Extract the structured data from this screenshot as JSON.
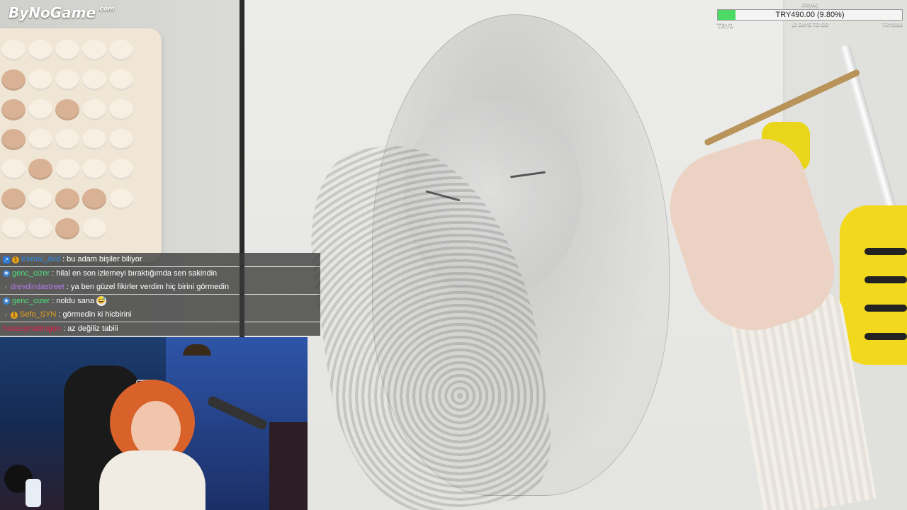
{
  "logo": {
    "text": "ByNoGame",
    "suffix": ".com"
  },
  "goal": {
    "title": "ihtiyaç",
    "amount": "TRY490.00 (9.80%)",
    "progress_percent": 9.8,
    "start_label": "TRY0",
    "days_left": "12 DAYS TO GO",
    "end_label": "TRY5000",
    "fill_color": "#4cd964"
  },
  "chat": {
    "messages": [
      {
        "badges": [
          "square",
          "coin"
        ],
        "user": "Kemal_dvd",
        "user_color": "#2b86e0",
        "text": ": bu adam bişiler biliyor"
      },
      {
        "badges": [
          "star"
        ],
        "user": "genc_cizer",
        "user_color": "#4de07a",
        "text": ": hilal en son izlemeyi bıraktığımda sen sakindin"
      },
      {
        "badges": [
          "arrow"
        ],
        "user": "drevdindastreet",
        "user_color": "#b57bea",
        "text": ": ya ben güzel fikirler verdim hiç birini görmedin"
      },
      {
        "badges": [
          "star"
        ],
        "user": "genc_cizer",
        "user_color": "#4de07a",
        "text": ": noldu sana",
        "emote": "😅"
      },
      {
        "badges": [
          "arrow",
          "coin"
        ],
        "user": "Sefo_SYN",
        "user_color": "#e8a317",
        "text": ": görmedin ki hicbirini"
      },
      {
        "badges": [],
        "user": "hoossyinaltingun",
        "user_color": "#e01e4a",
        "text": ": az değiliz tabiii"
      }
    ]
  }
}
